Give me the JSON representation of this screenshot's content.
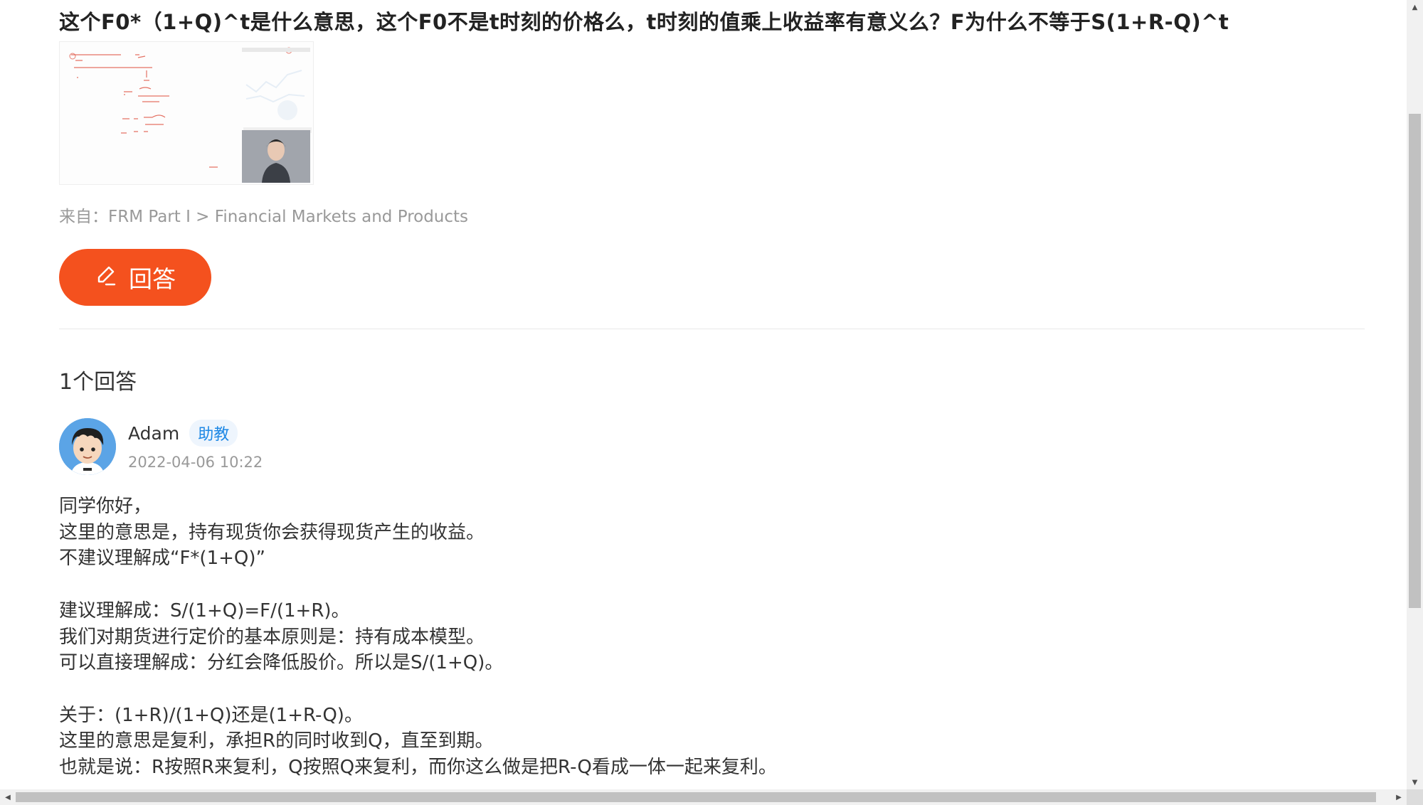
{
  "question": {
    "title": "这个F0*（1+Q)^t是什么意思，这个F0不是t时刻的价格么，t时刻的值乘上收益率有意义么？F为什么不等于S(1+R-Q)^t",
    "thumbnail_icon": "lecture-video-thumbnail",
    "source": "来自：FRM Part I > Financial Markets and Products"
  },
  "answer_button": {
    "label": "回答",
    "icon": "pen-icon"
  },
  "answers_section": {
    "count_label": "1个回答",
    "answers": [
      {
        "author": "Adam",
        "badge": "助教",
        "time": "2022-04-06 10:22",
        "lines": [
          "同学你好，",
          "这里的意思是，持有现货你会获得现货产生的收益。",
          "不建议理解成“F*(1+Q)”",
          "",
          "建议理解成：S/(1+Q)=F/(1+R)。",
          "我们对期货进行定价的基本原则是：持有成本模型。",
          "可以直接理解成：分红会降低股价。所以是S/(1+Q)。",
          "",
          "关于：(1+R)/(1+Q)还是(1+R-Q)。",
          "这里的意思是复利，承担R的同时收到Q，直至到期。",
          "也就是说：R按照R来复利，Q按照Q来复利，而你这么做是把R-Q看成一体一起来复利。"
        ]
      }
    ]
  },
  "colors": {
    "accent": "#f4511e",
    "badge": "#1e88e5",
    "muted": "#999999"
  }
}
